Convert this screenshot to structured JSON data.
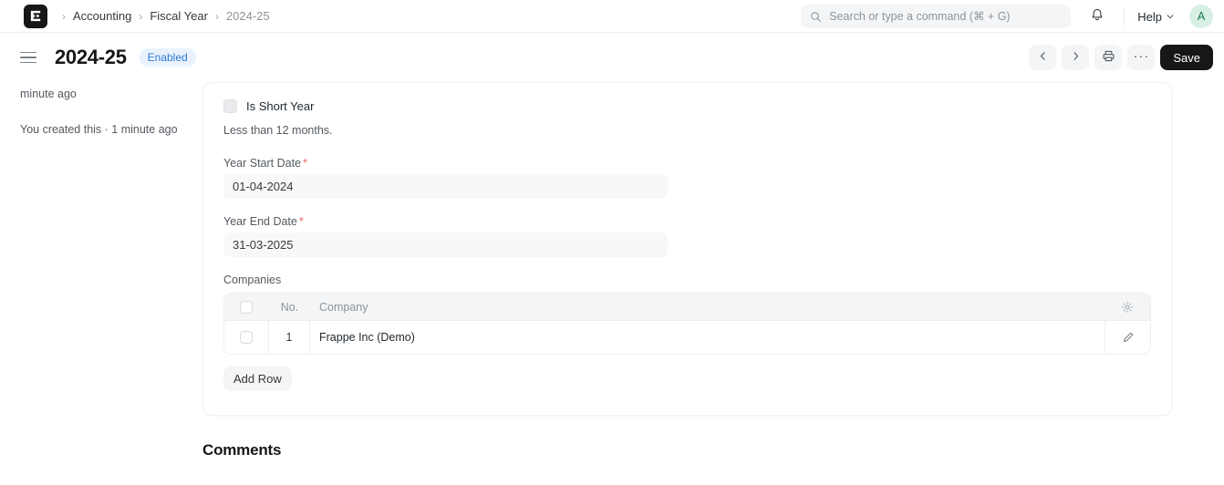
{
  "navbar": {
    "logo_icon": "frappe-logo-icon",
    "breadcrumb": {
      "separator": "›",
      "items": [
        {
          "label": "Accounting",
          "current": false
        },
        {
          "label": "Fiscal Year",
          "current": false
        },
        {
          "label": "2024-25",
          "current": true
        }
      ]
    },
    "search": {
      "icon": "search-icon",
      "placeholder": "Search or type a command (⌘ + G)",
      "value": ""
    },
    "notifications_icon": "bell-icon",
    "help_label": "Help",
    "help_chevron_icon": "chevron-down-icon",
    "avatar_initial": "A",
    "avatar_bg": "#d8f0e3",
    "avatar_color": "#17794e"
  },
  "page_head": {
    "menu_icon": "hamburger-icon",
    "title": "2024-25",
    "status_badge": {
      "label": "Enabled",
      "bg": "#eaf2fe",
      "color": "#2b7cd3"
    },
    "actions": {
      "prev_icon": "chevron-left-icon",
      "next_icon": "chevron-right-icon",
      "print_icon": "printer-icon",
      "more_label": "···",
      "save_label": "Save",
      "save_bg": "#171717"
    }
  },
  "sidebar": {
    "lines": [
      "minute ago",
      "You created this · 1 minute ago"
    ]
  },
  "form": {
    "is_short_year": {
      "label": "Is Short Year",
      "checked": false,
      "help_text": "Less than 12 months."
    },
    "year_start_date": {
      "label": "Year Start Date",
      "required": true,
      "required_mark": "*",
      "value": "01-04-2024"
    },
    "year_end_date": {
      "label": "Year End Date",
      "required": true,
      "required_mark": "*",
      "value": "31-03-2025"
    },
    "companies_grid": {
      "label": "Companies",
      "settings_icon": "gear-icon",
      "columns": [
        "",
        "No.",
        "Company",
        ""
      ],
      "headers": {
        "select_all": "",
        "no": "No.",
        "company": "Company"
      },
      "rows": [
        {
          "no": "1",
          "company": "Frappe Inc (Demo)",
          "selected": false,
          "edit_icon": "pencil-icon"
        }
      ],
      "add_row_label": "Add Row"
    }
  },
  "comments": {
    "heading": "Comments"
  }
}
